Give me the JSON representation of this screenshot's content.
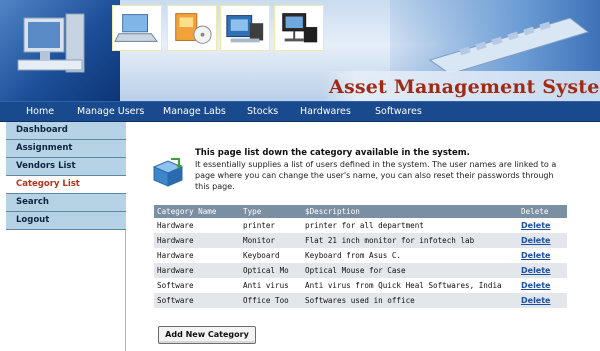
{
  "header": {
    "app_title": "Asset Management System"
  },
  "nav": {
    "items": [
      "Home",
      "Manage Users",
      "Manage Labs",
      "Stocks",
      "Hardwares",
      "Softwares"
    ]
  },
  "sidebar": {
    "items": [
      {
        "label": "Dashboard",
        "active": false
      },
      {
        "label": "Assignment",
        "active": false
      },
      {
        "label": "Vendors List",
        "active": false
      },
      {
        "label": "Category List",
        "active": true
      },
      {
        "label": "Search",
        "active": false
      },
      {
        "label": "Logout",
        "active": false
      }
    ]
  },
  "info": {
    "heading": "This page list down the category available in the system.",
    "body": "It essentially supplies a list of users defined in the system. The user names are linked to a page where you can change the user's name, you can also reset their passwords through this page."
  },
  "table": {
    "columns": [
      "Category Name",
      "Type",
      "$Description",
      "Delete"
    ],
    "rows": [
      {
        "category": "Hardware",
        "type": "printer",
        "description": "printer for all department",
        "action": "Delete"
      },
      {
        "category": "Hardware",
        "type": "Monitor",
        "description": "Flat 21 inch monitor for infotech lab",
        "action": "Delete"
      },
      {
        "category": "Hardware",
        "type": "Keyboard",
        "description": "Keyboard from Asus C.",
        "action": "Delete"
      },
      {
        "category": "Hardware",
        "type": "Optical Mo",
        "description": "Optical Mouse for Case",
        "action": "Delete"
      },
      {
        "category": "Software",
        "type": "Anti virus",
        "description": "Anti virus from Quick Heal Softwares, India",
        "action": "Delete"
      },
      {
        "category": "Software",
        "type": "Office Too",
        "description": "Softwares used in office",
        "action": "Delete"
      }
    ]
  },
  "actions": {
    "add_label": "Add New Category"
  },
  "colors": {
    "nav_bg": "#1a4a8e",
    "sidebar_bg": "#b6d3e6",
    "active_text": "#b8341c",
    "title_text": "#a02a14",
    "table_header_bg": "#7b8fa3",
    "link": "#1b4fa3"
  }
}
